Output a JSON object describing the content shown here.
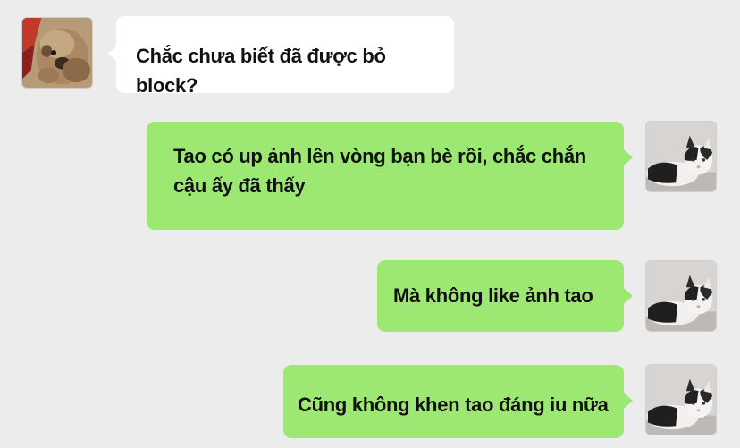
{
  "messages": [
    {
      "direction": "incoming",
      "sender_avatar": "dog-avatar",
      "text": "Chắc chưa biết đã được bỏ block?"
    },
    {
      "direction": "outgoing",
      "sender_avatar": "cat-avatar",
      "text": "Tao có up ảnh lên vòng bạn bè rồi, chắc chắn cậu ấy đã thấy"
    },
    {
      "direction": "outgoing",
      "sender_avatar": "cat-avatar",
      "text": "Mà không like ảnh tao"
    },
    {
      "direction": "outgoing",
      "sender_avatar": "cat-avatar",
      "text": "Cũng không khen tao đáng iu nữa"
    }
  ],
  "colors": {
    "background": "#ececec",
    "incoming_bubble": "#ffffff",
    "outgoing_bubble": "#9de872",
    "text": "#111111"
  }
}
